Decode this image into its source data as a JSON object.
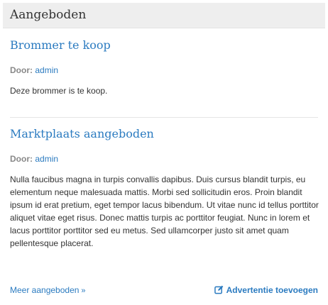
{
  "widget": {
    "title": "Aangeboden"
  },
  "posts": [
    {
      "title": "Brommer te koop",
      "meta_label": "Door:",
      "author": "admin",
      "excerpt": "Deze brommer is te koop."
    },
    {
      "title": "Marktplaats aangeboden",
      "meta_label": "Door:",
      "author": "admin",
      "excerpt": "Nulla faucibus magna in turpis convallis dapibus. Duis cursus blandit turpis, eu elementum neque malesuada mattis. Morbi sed sollicitudin eros. Proin blandit ipsum id erat pretium, eget tempor lacus bibendum. Ut vitae nunc id tellus porttitor aliquet vitae eget risus. Donec mattis turpis ac porttitor feugiat. Nunc in lorem et lacus porttitor porttitor sed eu metus. Sed ullamcorper justo sit amet quam pellentesque placerat."
    }
  ],
  "footer": {
    "more_label": "Meer aangeboden",
    "more_icon": "double-chevron-right-icon",
    "add_label": "Advertentie toevoegen",
    "add_icon": "edit-icon"
  },
  "colors": {
    "link": "#2b7bc0",
    "header_bg": "#eeeeee",
    "meta_label": "#888888",
    "text": "#333333"
  }
}
